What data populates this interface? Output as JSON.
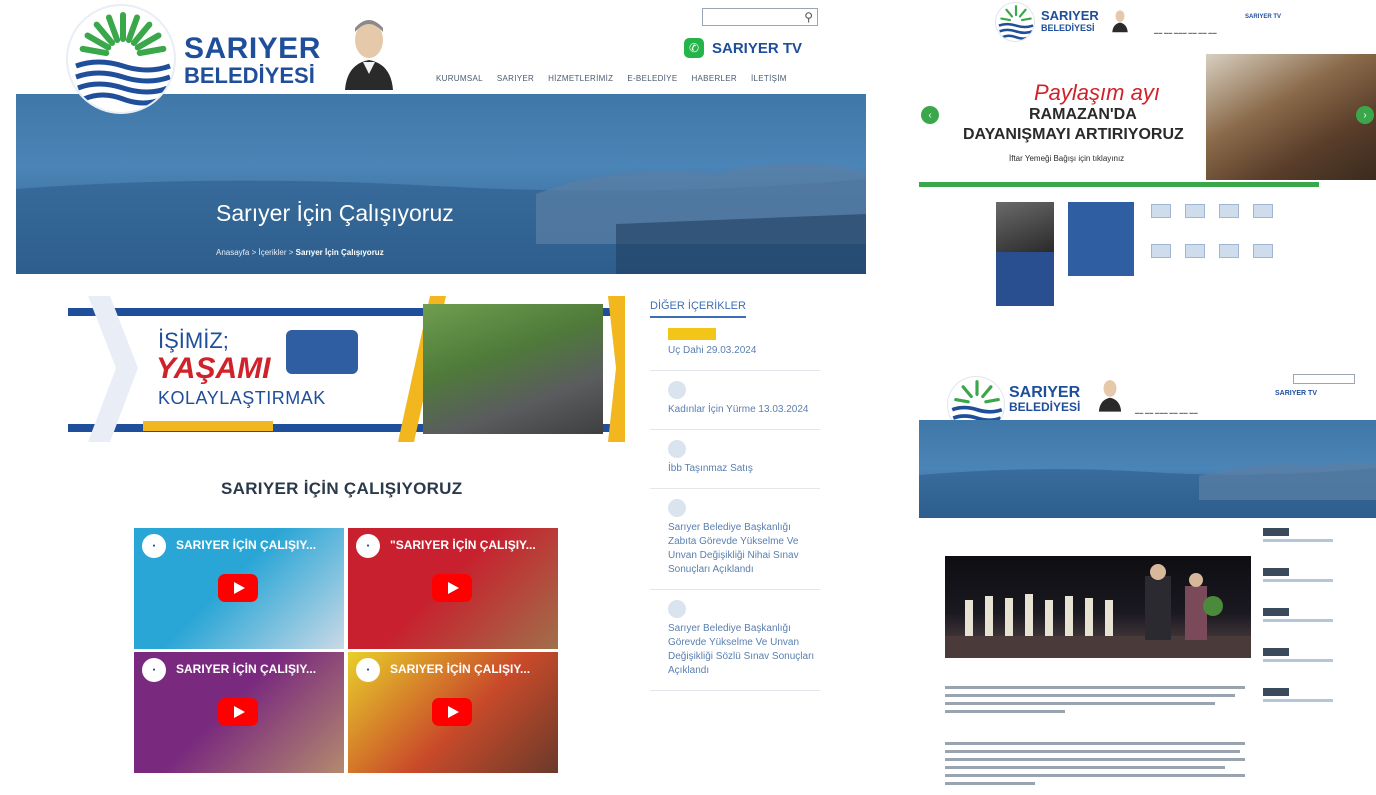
{
  "main": {
    "logo": {
      "line1": "SARIYER",
      "line2": "BELEDİYESİ"
    },
    "tv_label": "SARIYER TV",
    "nav": [
      "KURUMSAL",
      "SARIYER",
      "HİZMETLERİMİZ",
      "E-BELEDİYE",
      "HABERLER",
      "İLETİŞİM"
    ],
    "hero_title": "Sarıyer İçin Çalışıyoruz",
    "breadcrumb": {
      "home": "Anasayfa",
      "sep": ">",
      "section": "İçerikler",
      "current": "Sarıyer İçin Çalışıyoruz"
    },
    "banner": {
      "line1": "İŞİMİZ;",
      "line2": "YAŞAMI",
      "line3": "KOLAYLAŞTIRMAK"
    },
    "section_title": "SARIYER İÇİN ÇALIŞIYORUZ",
    "videos": [
      {
        "title": "SARIYER İÇİN ÇALIŞIY...",
        "bg": "#2aa6d6"
      },
      {
        "title": "\"SARIYER İÇİN ÇALIŞIY...",
        "bg": "#c8202e"
      },
      {
        "title": "SARIYER İÇİN ÇALIŞIY...",
        "bg": "#7a2a7e"
      },
      {
        "title": "SARIYER İÇİN ÇALIŞIY...",
        "bg": "#e8d02a"
      }
    ],
    "sidebar": {
      "title": "DİĞER İÇERİKLER",
      "items": [
        "Uç Dahi 29.03.2024",
        "Kadınlar İçin Yürme 13.03.2024",
        "İbb Taşınmaz Satış",
        "Sarıyer Belediye Başkanlığı Zabıta Görevde Yükselme Ve Unvan Değişikliği Nihai Sınav Sonuçları Açıklandı",
        "Sarıyer Belediye Başkanlığı Görevde Yükselme Ve Unvan Değişikliği Sözlü Sınav Sonuçları Açıklandı"
      ]
    }
  },
  "thumb1": {
    "logo": {
      "line1": "SARIYER",
      "line2": "BELEDİYESİ"
    },
    "tv_label": "SARIYER TV",
    "slide": {
      "line1": "Paylaşım ayı",
      "line2": "RAMAZAN'DA",
      "line3": "DAYANIŞMAYI ARTIRIYORUZ",
      "line4": "İftar Yemeği Bağışı için tıklayınız"
    },
    "arrow_left": "‹",
    "arrow_right": "›"
  },
  "thumb2": {
    "logo": {
      "line1": "SARIYER",
      "line2": "BELEDİYESİ"
    },
    "tv_label": "SARIYER TV"
  },
  "colors": {
    "brand_blue": "#1f4e9a",
    "accent_green": "#3aa84a",
    "accent_red": "#d0222a"
  }
}
